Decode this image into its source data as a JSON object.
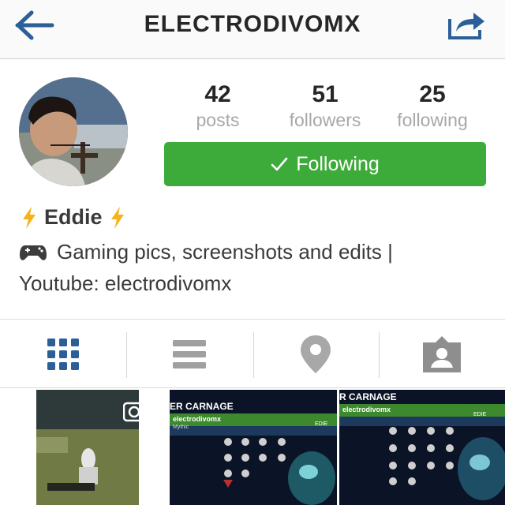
{
  "header": {
    "title": "ELECTRODIVOMX",
    "back_icon": "back-arrow-icon",
    "share_icon": "share-icon",
    "accent": "#2c5f97"
  },
  "profile": {
    "stats": [
      {
        "value": "42",
        "label": "posts"
      },
      {
        "value": "51",
        "label": "followers"
      },
      {
        "value": "25",
        "label": "following"
      }
    ],
    "follow_button": "Following",
    "follow_color": "#3dab3a",
    "name": "Eddie",
    "bio_line1": "Gaming pics, screenshots and edits |",
    "bio_line2": "Youtube: electrodivomx"
  },
  "tabs": [
    {
      "icon": "grid-icon",
      "active": true
    },
    {
      "icon": "list-icon",
      "active": false
    },
    {
      "icon": "location-pin-icon",
      "active": false
    },
    {
      "icon": "tagged-photos-icon",
      "active": false
    }
  ],
  "grid": {
    "thumb2_title": "ER CARNAGE",
    "thumb2_user": "electrodivomx",
    "thumb2_sub": "Mythic",
    "thumb2_tag": "EDIE",
    "thumb3_title": "R CARNAGE",
    "thumb3_user": "electrodivomx",
    "thumb3_tag": "EDIE"
  }
}
